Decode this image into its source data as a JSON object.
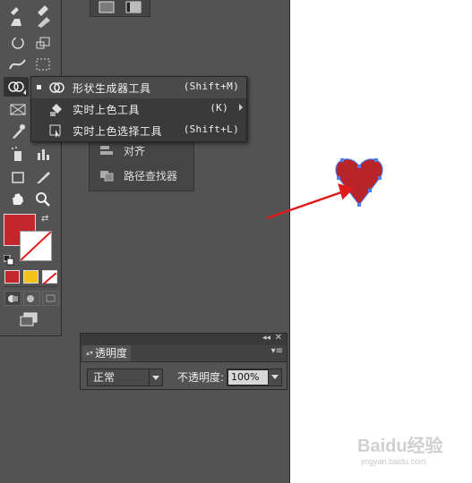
{
  "flyout": {
    "items": [
      {
        "label": "形状生成器工具",
        "shortcut": "(Shift+M)",
        "icon": "shape-builder-icon"
      },
      {
        "label": "实时上色工具",
        "shortcut": "(K)",
        "icon": "live-paint-bucket-icon"
      },
      {
        "label": "实时上色选择工具",
        "shortcut": "(Shift+L)",
        "icon": "live-paint-selection-icon"
      }
    ]
  },
  "pathfinder_panel": {
    "items": [
      {
        "label": "对齐",
        "icon": "align-icon"
      },
      {
        "label": "路径查找器",
        "icon": "pathfinder-icon"
      }
    ]
  },
  "transparency": {
    "tab": "透明度",
    "blend_mode": "正常",
    "opacity_label": "不透明度:",
    "opacity_value": "100%"
  },
  "colors": {
    "fill": "#c4262e",
    "heart": "#b7242a",
    "arrow": "#e01b1b",
    "selection": "#4a7fff",
    "swatch_color": "#c4262e",
    "swatch_gradient": "#f2c21b"
  },
  "watermark": {
    "title": "Baidu经验",
    "url": "jingyan.baidu.com"
  }
}
